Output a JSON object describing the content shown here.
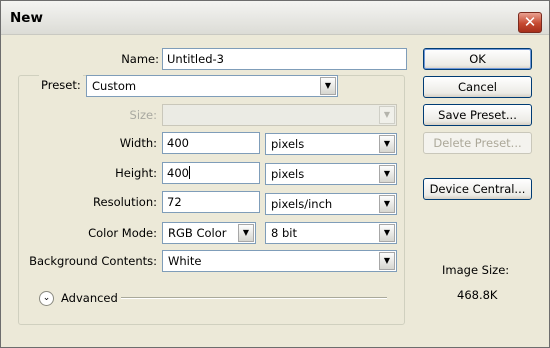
{
  "dialog": {
    "title": "New"
  },
  "name_field": {
    "label": "Name:",
    "value": "Untitled-3"
  },
  "preset": {
    "label": "Preset:",
    "value": "Custom"
  },
  "size": {
    "label": "Size:",
    "value": ""
  },
  "width": {
    "label": "Width:",
    "value": "400",
    "unit": "pixels"
  },
  "height": {
    "label": "Height:",
    "value": "400",
    "unit": "pixels"
  },
  "resolution": {
    "label": "Resolution:",
    "value": "72",
    "unit": "pixels/inch"
  },
  "color_mode": {
    "label": "Color Mode:",
    "value": "RGB Color",
    "bit_depth": "8 bit"
  },
  "background": {
    "label": "Background Contents:",
    "value": "White"
  },
  "advanced": {
    "label": "Advanced"
  },
  "buttons": {
    "ok": "OK",
    "cancel": "Cancel",
    "save_preset": "Save Preset...",
    "delete_preset": "Delete Preset...",
    "device_central": "Device Central..."
  },
  "image_size": {
    "label": "Image Size:",
    "value": "468.8K"
  },
  "icons": {
    "close": "close-icon",
    "dropdown": "chevron-down-icon",
    "advanced": "double-chevron-down-icon"
  },
  "colors": {
    "window_bg": "#ece9d8",
    "field_border": "#7f9db9",
    "close_red": "#c64a31"
  }
}
